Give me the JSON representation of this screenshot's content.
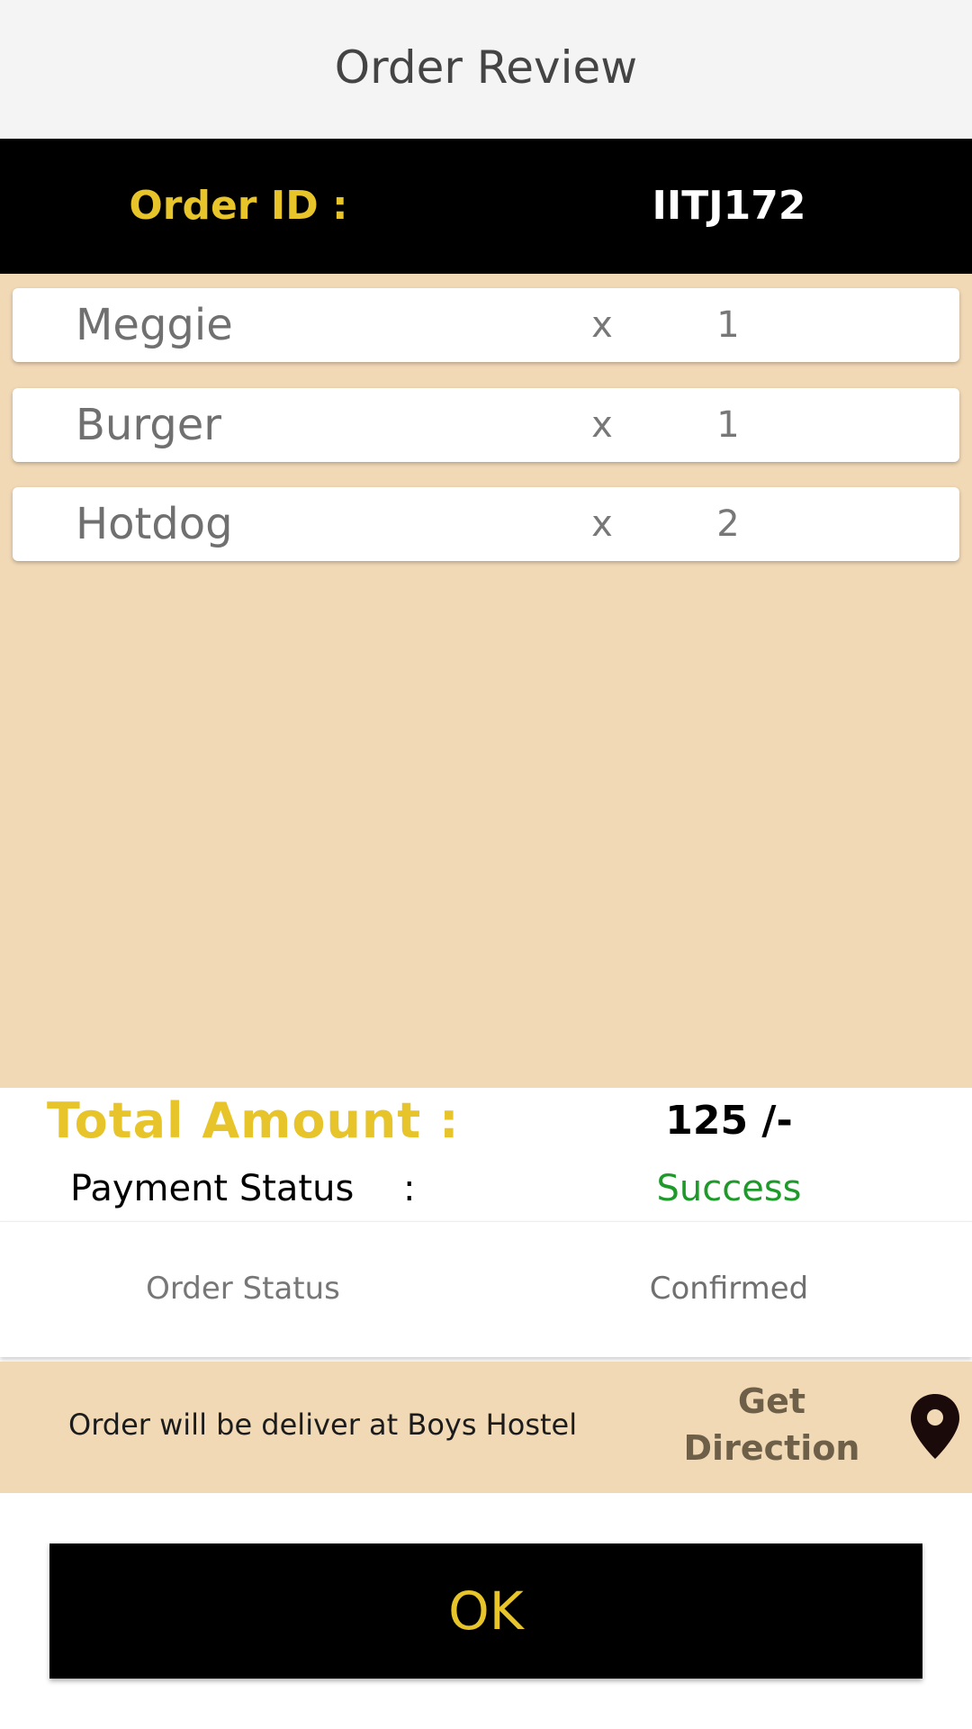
{
  "header": {
    "title": "Order Review"
  },
  "order": {
    "id_label": "Order ID :",
    "id_value": "IITJ172"
  },
  "items": [
    {
      "name": "Meggie",
      "x": "x",
      "qty": "1"
    },
    {
      "name": "Burger",
      "x": "x",
      "qty": "1"
    },
    {
      "name": "Hotdog",
      "x": "x",
      "qty": "2"
    }
  ],
  "total": {
    "label": "Total Amount :",
    "value": "125 /-"
  },
  "payment": {
    "label": "Payment Status",
    "colon": ":",
    "value": "Success"
  },
  "order_status": {
    "label": "Order Status",
    "value": "Confirmed"
  },
  "delivery": {
    "text": "Order will be deliver at Boys Hostel",
    "direction_line1": "Get",
    "direction_line2": "Direction",
    "icon": "location-pin-icon"
  },
  "actions": {
    "ok_label": "OK"
  },
  "colors": {
    "accent_yellow": "#e7c42a",
    "panel_beige": "#f1d9b6",
    "success_green": "#1e9a2a",
    "header_black": "#000000"
  }
}
